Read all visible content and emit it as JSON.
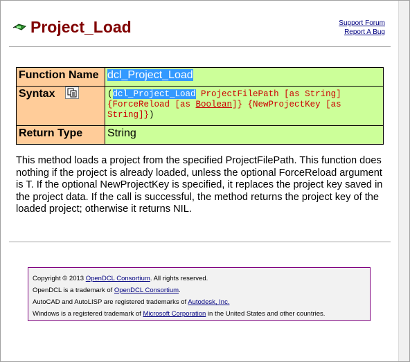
{
  "header": {
    "title": "Project_Load",
    "links": [
      "Support Forum",
      "Report A Bug"
    ]
  },
  "table": {
    "rows": [
      {
        "label": "Function Name",
        "value": "dcl_Project_Load"
      },
      {
        "label": "Syntax"
      },
      {
        "label": "Return Type",
        "value": "String"
      }
    ],
    "syntax": {
      "open": "(",
      "func": "dcl_Project_Load",
      "arg1": " ProjectFilePath [as String]",
      "arg2_open": "{ForceReload [as ",
      "arg2_type": "Boolean",
      "arg2_close": "]} {NewProjectKey [as",
      "arg3": "String]}",
      "close": ")"
    }
  },
  "description": "This method loads a project from the specified ProjectFilePath. This function does nothing if the project is already loaded, unless the optional ForceReload argument is T. If the optional NewProjectKey is specified, it replaces the project key saved in the project data. If the call is successful, the method returns the project key of the loaded project; otherwise it returns NIL.",
  "footer": {
    "line1_pre": "Copyright © 2013 ",
    "line1_link": "OpenDCL Consortium",
    "line1_post": ". All rights reserved.",
    "line2_pre": "OpenDCL is a trademark of ",
    "line2_link": "OpenDCL Consortium",
    "line2_post": ".",
    "line3_pre": "AutoCAD and AutoLISP are registered trademarks of ",
    "line3_link": "Autodesk, Inc.",
    "line4_pre": "Windows is a registered trademark of ",
    "line4_link": "Microsoft Corporation",
    "line4_post": " in the United States and other countries."
  },
  "colors": {
    "title": "#800000",
    "label_bg": "#ffcc99",
    "value_bg": "#ccff99",
    "selection": "#3399ff",
    "link": "#000080",
    "footer_border": "#800080"
  },
  "icons": [
    "project-icon",
    "copy-icon"
  ]
}
